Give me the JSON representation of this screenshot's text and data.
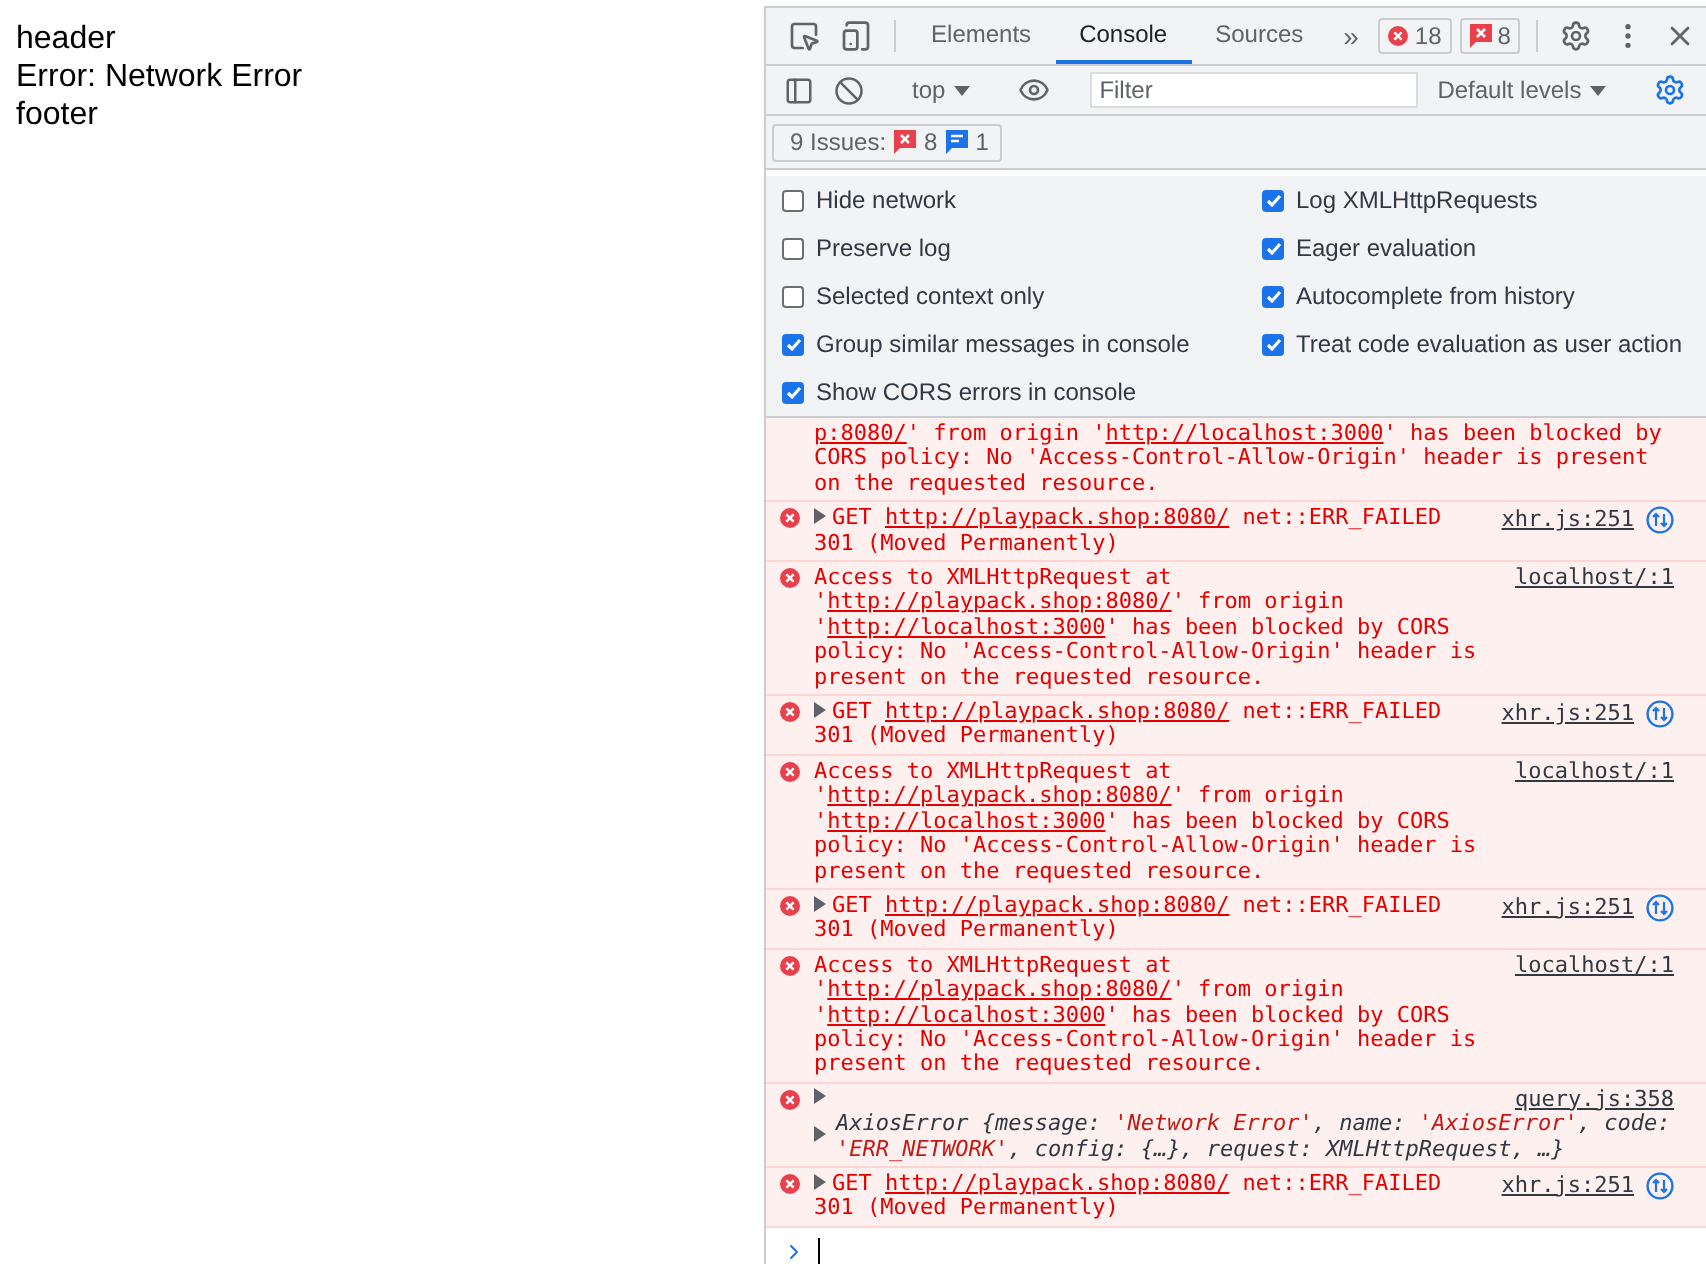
{
  "page": {
    "lines": [
      "header",
      "Error: Network Error",
      "footer"
    ]
  },
  "devtools": {
    "tabs": [
      {
        "label": "Elements",
        "selected": false
      },
      {
        "label": "Console",
        "selected": true
      },
      {
        "label": "Sources",
        "selected": false
      }
    ],
    "more": "»",
    "error_count": "18",
    "issue_count": "8",
    "toolbar": {
      "context": "top",
      "filter": {
        "placeholder": "Filter"
      },
      "levels": "Default levels"
    },
    "issues": {
      "label": "9 Issues:",
      "errors": "8",
      "info": "1"
    },
    "settings": [
      {
        "label": "Hide network",
        "checked": false
      },
      {
        "label": "Log XMLHttpRequests",
        "checked": true
      },
      {
        "label": "Preserve log",
        "checked": false
      },
      {
        "label": "Eager evaluation",
        "checked": true
      },
      {
        "label": "Selected context only",
        "checked": false
      },
      {
        "label": "Autocomplete from history",
        "checked": true
      },
      {
        "label": "Group similar messages in console",
        "checked": true
      },
      {
        "label": "Treat code evaluation as user action",
        "checked": true
      },
      {
        "label": "Show CORS errors in console",
        "checked": true
      }
    ],
    "messages": [
      {
        "kind": "continuation",
        "parts": [
          {
            "kind": "link",
            "text": "p:8080/"
          },
          {
            "kind": "text",
            "text": "' from origin '"
          },
          {
            "kind": "link",
            "text": "http://localhost:3000"
          },
          {
            "kind": "text",
            "text": "' has been blocked by CORS policy: No 'Access-Control-Allow-Origin' header is present on the requested resource."
          }
        ]
      },
      {
        "kind": "get",
        "expanded": false,
        "source": "xhr.js:251",
        "parts": [
          {
            "kind": "text",
            "text": "GET "
          },
          {
            "kind": "link",
            "text": "http://playpack.shop:8080/"
          },
          {
            "kind": "text",
            "text": " net::ERR_FAILED 301 (Moved Permanently)"
          }
        ]
      },
      {
        "kind": "cors",
        "source": "localhost/:1",
        "parts": [
          {
            "kind": "text",
            "text": "Access to XMLHttpRequest at '"
          },
          {
            "kind": "link",
            "text": "http://playpack.shop:8080/"
          },
          {
            "kind": "text",
            "text": "' from origin '"
          },
          {
            "kind": "link",
            "text": "http://localhost:3000"
          },
          {
            "kind": "text",
            "text": "' has been blocked by CORS policy: No 'Access-Control-Allow-Origin' header is present on the requested resource."
          }
        ]
      },
      {
        "kind": "get",
        "expanded": false,
        "source": "xhr.js:251",
        "parts": [
          {
            "kind": "text",
            "text": "GET "
          },
          {
            "kind": "link",
            "text": "http://playpack.shop:8080/"
          },
          {
            "kind": "text",
            "text": " net::ERR_FAILED 301 (Moved Permanently)"
          }
        ]
      },
      {
        "kind": "cors",
        "source": "localhost/:1",
        "parts": [
          {
            "kind": "text",
            "text": "Access to XMLHttpRequest at '"
          },
          {
            "kind": "link",
            "text": "http://playpack.shop:8080/"
          },
          {
            "kind": "text",
            "text": "' from origin '"
          },
          {
            "kind": "link",
            "text": "http://localhost:3000"
          },
          {
            "kind": "text",
            "text": "' has been blocked by CORS policy: No 'Access-Control-Allow-Origin' header is present on the requested resource."
          }
        ]
      },
      {
        "kind": "get",
        "expanded": false,
        "source": "xhr.js:251",
        "parts": [
          {
            "kind": "text",
            "text": "GET "
          },
          {
            "kind": "link",
            "text": "http://playpack.shop:8080/"
          },
          {
            "kind": "text",
            "text": " net::ERR_FAILED 301 (Moved Permanently)"
          }
        ]
      },
      {
        "kind": "cors",
        "source": "localhost/:1",
        "parts": [
          {
            "kind": "text",
            "text": "Access to XMLHttpRequest at '"
          },
          {
            "kind": "link",
            "text": "http://playpack.shop:8080/"
          },
          {
            "kind": "text",
            "text": "' from origin '"
          },
          {
            "kind": "link",
            "text": "http://localhost:3000"
          },
          {
            "kind": "text",
            "text": "' has been blocked by CORS policy: No 'Access-Control-Allow-Origin' header is present on the requested resource."
          }
        ]
      },
      {
        "kind": "object",
        "expanded": false,
        "object_expanded": false,
        "source": "query.js:358",
        "parts": [
          {
            "kind": "key",
            "text": "AxiosError {message: "
          },
          {
            "kind": "string",
            "text": "'Network Error'"
          },
          {
            "kind": "key",
            "text": ", name: "
          },
          {
            "kind": "string",
            "text": "'AxiosError'"
          },
          {
            "kind": "key",
            "text": ", code: "
          },
          {
            "kind": "string",
            "text": "'ERR_NETWORK'"
          },
          {
            "kind": "key",
            "text": ", config: {…}, request: XMLHttpRequest, …}"
          }
        ]
      },
      {
        "kind": "get",
        "expanded": false,
        "source": "xhr.js:251",
        "parts": [
          {
            "kind": "text",
            "text": "GET "
          },
          {
            "kind": "link",
            "text": "http://playpack.shop:8080/"
          },
          {
            "kind": "text",
            "text": " net::ERR_FAILED 301 (Moved Permanently)"
          }
        ]
      }
    ]
  }
}
